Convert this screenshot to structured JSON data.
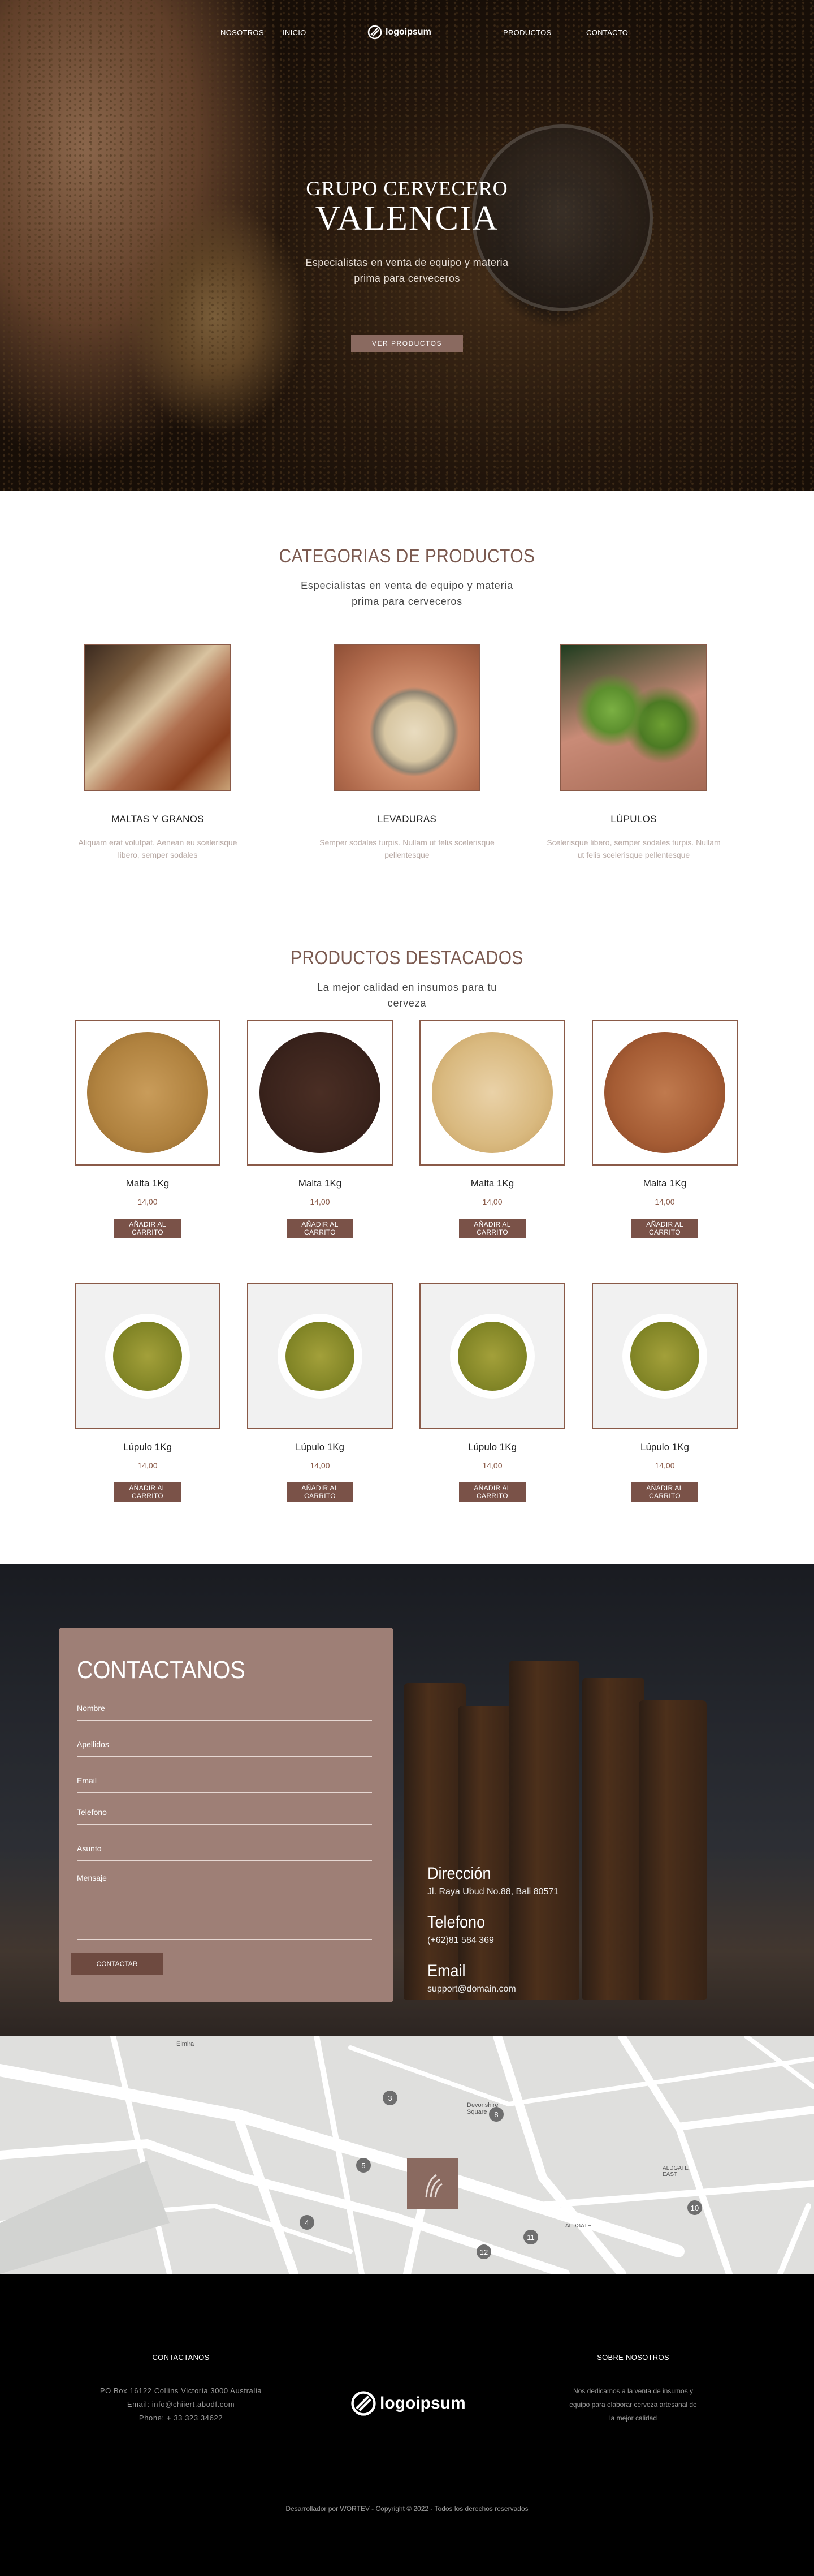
{
  "nav": {
    "items": [
      "NOSOTROS",
      "INICIO",
      "PRODUCTOS",
      "CONTACTO"
    ],
    "logo_text": "logoipsum"
  },
  "hero": {
    "small_title": "GRUPO CERVECERO",
    "big_title": "VALENCIA",
    "subtitle": "Especialistas en venta de equipo y materia prima para cerveceros",
    "button": "VER PRODUCTOS"
  },
  "categories": {
    "title": "CATEGORIAS DE PRODUCTOS",
    "subtitle": "Especialistas en venta de equipo y materia prima para cerveceros",
    "items": [
      {
        "name": "MALTAS Y GRANOS",
        "desc": "Aliquam erat volutpat. Aenean eu scelerisque libero, semper sodales"
      },
      {
        "name": "LEVADURAS",
        "desc": "Semper sodales turpis. Nullam ut felis scelerisque pellentesque"
      },
      {
        "name": "LÚPULOS",
        "desc": "Scelerisque libero, semper sodales turpis. Nullam ut felis scelerisque pellentesque"
      }
    ]
  },
  "featured": {
    "title": "PRODUCTOS DESTACADOS",
    "subtitle": "La mejor calidad en insumos para tu cerveza",
    "add_label": "AÑADIR AL CARRITO",
    "products": [
      {
        "name": "Malta 1Kg",
        "price": "14,00"
      },
      {
        "name": "Malta 1Kg",
        "price": "14,00"
      },
      {
        "name": "Malta 1Kg",
        "price": "14,00"
      },
      {
        "name": "Malta 1Kg",
        "price": "14,00"
      },
      {
        "name": "Lúpulo 1Kg",
        "price": "14,00"
      },
      {
        "name": "Lúpulo 1Kg",
        "price": "14,00"
      },
      {
        "name": "Lúpulo 1Kg",
        "price": "14,00"
      },
      {
        "name": "Lúpulo 1Kg",
        "price": "14,00"
      }
    ]
  },
  "contact": {
    "title": "CONTACTANOS",
    "fields": [
      "Nombre",
      "Apellidos",
      "Email",
      "Telefono",
      "Asunto",
      "Mensaje"
    ],
    "button": "CONTACTAR",
    "address_title": "Dirección",
    "address": "Jl. Raya Ubud No.88, Bali 80571",
    "phone_title": "Telefono",
    "phone": "(+62)81 584 369",
    "email_title": "Email",
    "email": "support@domain.com"
  },
  "map": {
    "labels": [
      "Elmira",
      "Devonshire Square",
      "ALDGATE EAST",
      "ALDGATE"
    ],
    "pins": [
      "3",
      "8",
      "5",
      "4",
      "11",
      "12",
      "10"
    ]
  },
  "footer": {
    "left_title": "CONTACTANOS",
    "left_lines": [
      "PO Box 16122 Collins Victoria 3000 Australia",
      "Email: info@chiiert.abodf.com",
      "Phone: + 33 323 34622"
    ],
    "logo_text": "logoipsum",
    "right_title": "SOBRE NOSOTROS",
    "right_lines": [
      "Nos dedicamos a la venta de insumos y",
      "equipo para elaborar cerveza artesanal de",
      "la mejor calidad"
    ],
    "copyright": "Desarrollador por WORTEV - Copyright © 2022 - Todos los derechos reservados"
  },
  "colors": {
    "accent": "#7a5248",
    "title": "#7b5a50",
    "form_bg": "#9e7f76"
  }
}
